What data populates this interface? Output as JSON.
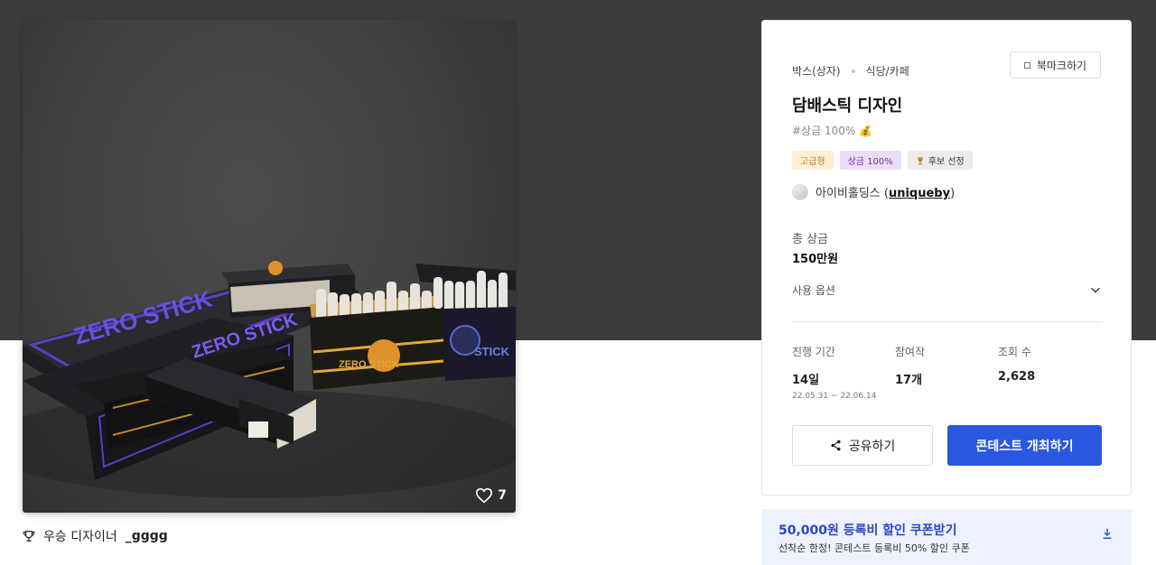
{
  "contest": {
    "category_main": "박스(상자)",
    "category_sub": "식당/카페",
    "bookmark_label": "북마크하기",
    "title": "담배스틱 디자인",
    "hashtag": "#상금 100% 💰",
    "tags": [
      "고급형",
      "상금 100%",
      "후보 선정"
    ],
    "host_name": "아이비홀딩스 (",
    "host_handle": "uniqueby",
    "host_close": ")"
  },
  "prize": {
    "label": "총 상금",
    "value": "150만원",
    "options_label": "사용 옵션"
  },
  "stats": {
    "period_label": "진행 기간",
    "period_value": "14일",
    "period_range": "22.05.31 ~ 22.06.14",
    "entries_label": "참여작",
    "entries_value": "17개",
    "views_label": "조회 수",
    "views_value": "2,628"
  },
  "actions": {
    "share_label": "공유하기",
    "host_label": "콘테스트 개최하기"
  },
  "coupon": {
    "title": "50,000원 등록비 할인 쿠폰받기",
    "subtitle": "선착순 한정! 콘테스트 등록비 50% 할인 쿠폰"
  },
  "artwork": {
    "likes": "7",
    "winner_label": "우승 디자이너",
    "winner_name": "_gggg",
    "box_text_main": "ZERO STICK",
    "box_text_orange": "ZERO STICK",
    "box_text_blue": "STICK",
    "box_text_small": "ZERO STICK"
  },
  "colors": {
    "hero_bg": "#3d3e3c",
    "primary": "#2a57e0",
    "coupon_bg": "#eef2fd",
    "coupon_text": "#2948c6",
    "purple_accent": "#5b3fc4",
    "orange_accent": "#e0902a"
  },
  "icons": {
    "like": "heart-outline-icon",
    "winner": "trophy-icon",
    "bookmark": "bookmark-icon",
    "options": "chevron-down-icon",
    "share": "share-icon",
    "download": "download-icon",
    "tag_trophy": "trophy-icon"
  }
}
